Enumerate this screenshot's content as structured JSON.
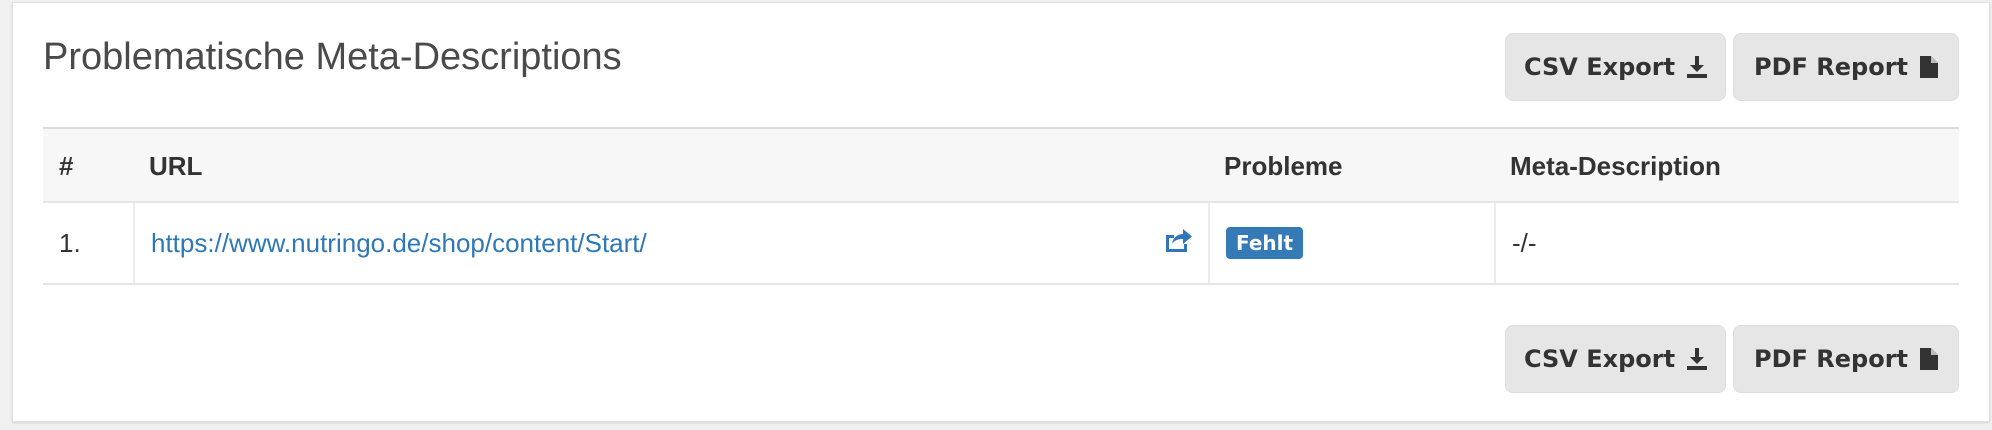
{
  "panel": {
    "title": "Problematische Meta-Descriptions"
  },
  "buttons": {
    "csv_export": "CSV Export",
    "pdf_report": "PDF Report",
    "csv_icon": "download-icon",
    "pdf_icon": "file-icon"
  },
  "table": {
    "headers": [
      "#",
      "URL",
      "Probleme",
      "Meta-Description"
    ],
    "rows": [
      {
        "num": "1.",
        "url": "https://www.nutringo.de/shop/content/Start/",
        "url_icon": "external-link-icon",
        "problem": "Fehlt",
        "meta_description": "-/-"
      }
    ]
  },
  "colors": {
    "link": "#2f78b8",
    "badge": "#337ab7",
    "button_bg": "#e6e6e6"
  }
}
